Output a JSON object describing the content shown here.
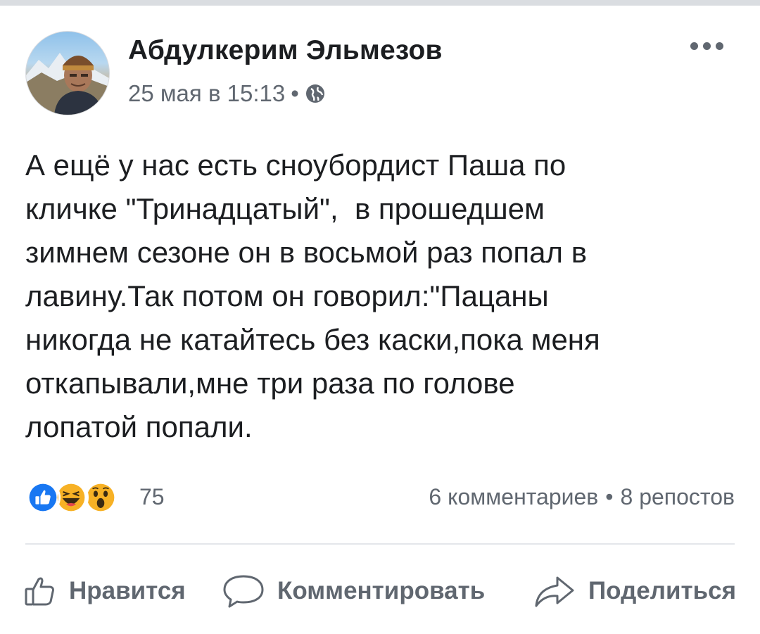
{
  "post": {
    "author": "Абдулкерим Эльмезов",
    "date": "25 мая в 15:13",
    "separator": "•",
    "privacy_icon": "globe-icon",
    "text": "А ещё у нас есть сноубордист Паша по\nкличке \"Тринадцатый\",  в прошедшем\nзимнем сезоне он в восьмой раз попал в\nлавину.Так потом он говорил:\"Пацаны\nникогда не катайтесь без каски,пока меня\nоткапывали,мне три раза по голове\nлопатой попали."
  },
  "reactions": {
    "icons": [
      "like-reaction-icon",
      "haha-reaction-icon",
      "wow-reaction-icon"
    ],
    "count": "75",
    "comments": "6 комментариев",
    "separator": "•",
    "shares": "8 репостов"
  },
  "actions": {
    "like": "Нравится",
    "comment": "Комментировать",
    "share": "Поделиться"
  },
  "colors": {
    "like_blue": "#1877f2",
    "reaction_yellow": "#f7b125",
    "text": "#1c1e21",
    "muted": "#606770",
    "divider": "#e4e6eb"
  }
}
